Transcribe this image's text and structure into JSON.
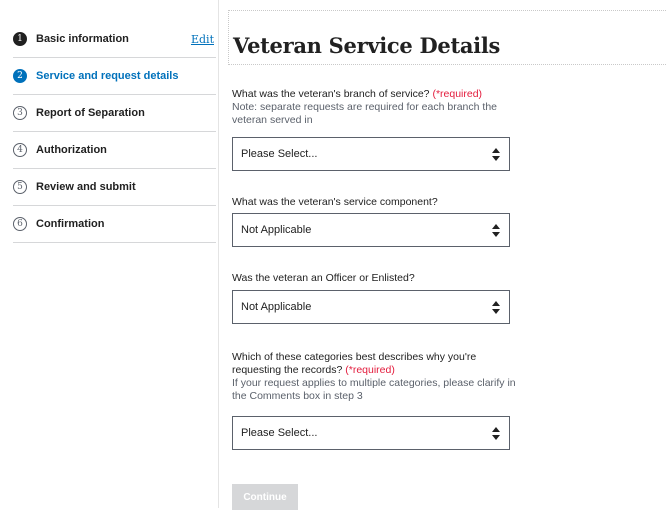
{
  "steps": [
    {
      "number": "1",
      "label": "Basic information",
      "action": "Edit",
      "state": "done"
    },
    {
      "number": "2",
      "label": "Service and request details",
      "state": "current"
    },
    {
      "number": "3",
      "label": "Report of Separation",
      "state": "upcoming"
    },
    {
      "number": "4",
      "label": "Authorization",
      "state": "upcoming"
    },
    {
      "number": "5",
      "label": "Review and submit",
      "state": "upcoming"
    },
    {
      "number": "6",
      "label": "Confirmation",
      "state": "upcoming"
    }
  ],
  "page": {
    "title": "Veteran Service Details"
  },
  "questions": {
    "branch": {
      "label": "What was the veteran's branch of service?",
      "required": "(*required)",
      "note": "Note: separate requests are required for each branch the veteran served in",
      "value": "Please Select..."
    },
    "component": {
      "label": "What was the veteran's service component?",
      "value": "Not Applicable"
    },
    "officer": {
      "label": "Was the veteran an Officer or Enlisted?",
      "value": "Not Applicable"
    },
    "category": {
      "label": "Which of these categories best describes why you're requesting the records?",
      "required": "(*required)",
      "note": "If your request applies to multiple categories, please clarify in the Comments box in step 3",
      "value": "Please Select..."
    }
  },
  "actions": {
    "continue_label": "Continue"
  },
  "colors": {
    "accent": "#0071bb",
    "required": "#e31c3d",
    "disabled_button": "#d6d7d9"
  },
  "icons": {
    "select_arrows": "sort-arrows-icon"
  }
}
